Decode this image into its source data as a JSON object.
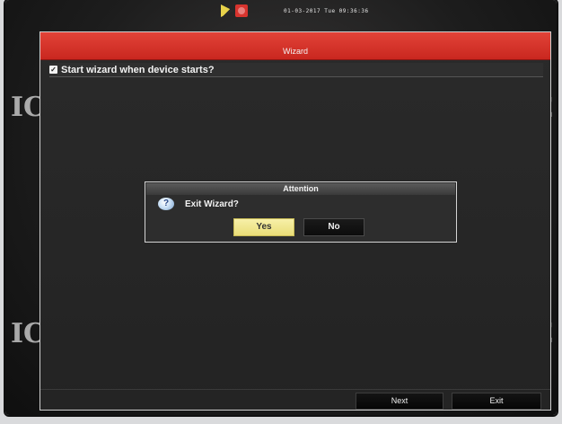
{
  "status_bar": {
    "datetime": "01-03-2017 Tue 09:36:36",
    "icons": [
      "hdd-status-icon",
      "alarm-status-icon"
    ]
  },
  "side_text": {
    "left": "IC",
    "right": "E"
  },
  "wizard": {
    "title": "Wizard",
    "start_checkbox": {
      "checked": true,
      "label": "Start wizard when device starts?"
    },
    "footer": {
      "next_label": "Next",
      "exit_label": "Exit"
    }
  },
  "dialog": {
    "title": "Attention",
    "icon": "question-icon",
    "message": "Exit Wizard?",
    "yes_label": "Yes",
    "no_label": "No"
  },
  "colors": {
    "titlebar_red": "#d63128",
    "yes_highlight": "#f1e68e",
    "window_bg": "#262626"
  }
}
